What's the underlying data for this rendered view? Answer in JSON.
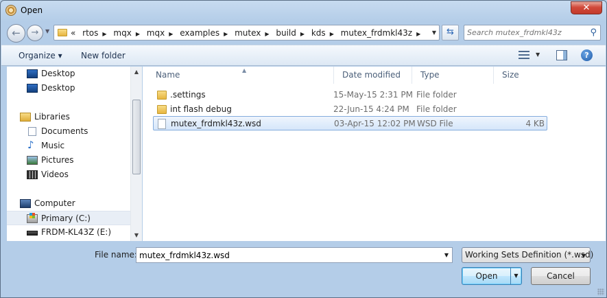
{
  "window": {
    "title": "Open",
    "close_glyph": "✕"
  },
  "address_bar": {
    "overflow_glyph": "«",
    "crumbs": [
      "rtos",
      "mqx",
      "mqx",
      "examples",
      "mutex",
      "build",
      "kds",
      "mutex_frdmkl43z"
    ],
    "search_placeholder": "Search mutex_frdmkl43z"
  },
  "toolbar": {
    "organize_label": "Organize ▾",
    "new_folder_label": "New folder"
  },
  "nav_pane": {
    "items": [
      {
        "label": "Desktop",
        "icon": "desktop-icon"
      },
      {
        "label": "Desktop",
        "icon": "desktop-icon"
      },
      {
        "label": "Libraries",
        "icon": "libraries-icon"
      },
      {
        "label": "Documents",
        "icon": "documents-icon"
      },
      {
        "label": "Music",
        "icon": "music-icon"
      },
      {
        "label": "Pictures",
        "icon": "pictures-icon"
      },
      {
        "label": "Videos",
        "icon": "videos-icon"
      },
      {
        "label": "Computer",
        "icon": "computer-icon"
      },
      {
        "label": "Primary (C:)",
        "icon": "drive-icon",
        "selected": true
      },
      {
        "label": "FRDM-KL43Z (E:)",
        "icon": "usb-drive-icon"
      }
    ]
  },
  "file_list": {
    "columns": [
      "Name",
      "Date modified",
      "Type",
      "Size"
    ],
    "rows": [
      {
        "name": ".settings",
        "date": "15-May-15 2:31 PM",
        "type": "File folder",
        "size": "",
        "icon": "folder-icon"
      },
      {
        "name": "int flash debug",
        "date": "22-Jun-15 4:24 PM",
        "type": "File folder",
        "size": "",
        "icon": "folder-icon"
      },
      {
        "name": "mutex_frdmkl43z.wsd",
        "date": "03-Apr-15 12:02 PM",
        "type": "WSD File",
        "size": "4 KB",
        "icon": "file-icon",
        "selected": true
      }
    ]
  },
  "bottom": {
    "file_name_label": "File name:",
    "file_name_value": "mutex_frdmkl43z.wsd",
    "filter_value": "Working Sets Definition (*.wsd)",
    "open_label": "Open",
    "cancel_label": "Cancel"
  },
  "colors": {
    "selection_bg": "#d5e6fa",
    "selection_border": "#84acdd",
    "frame": "#b4cde8"
  }
}
